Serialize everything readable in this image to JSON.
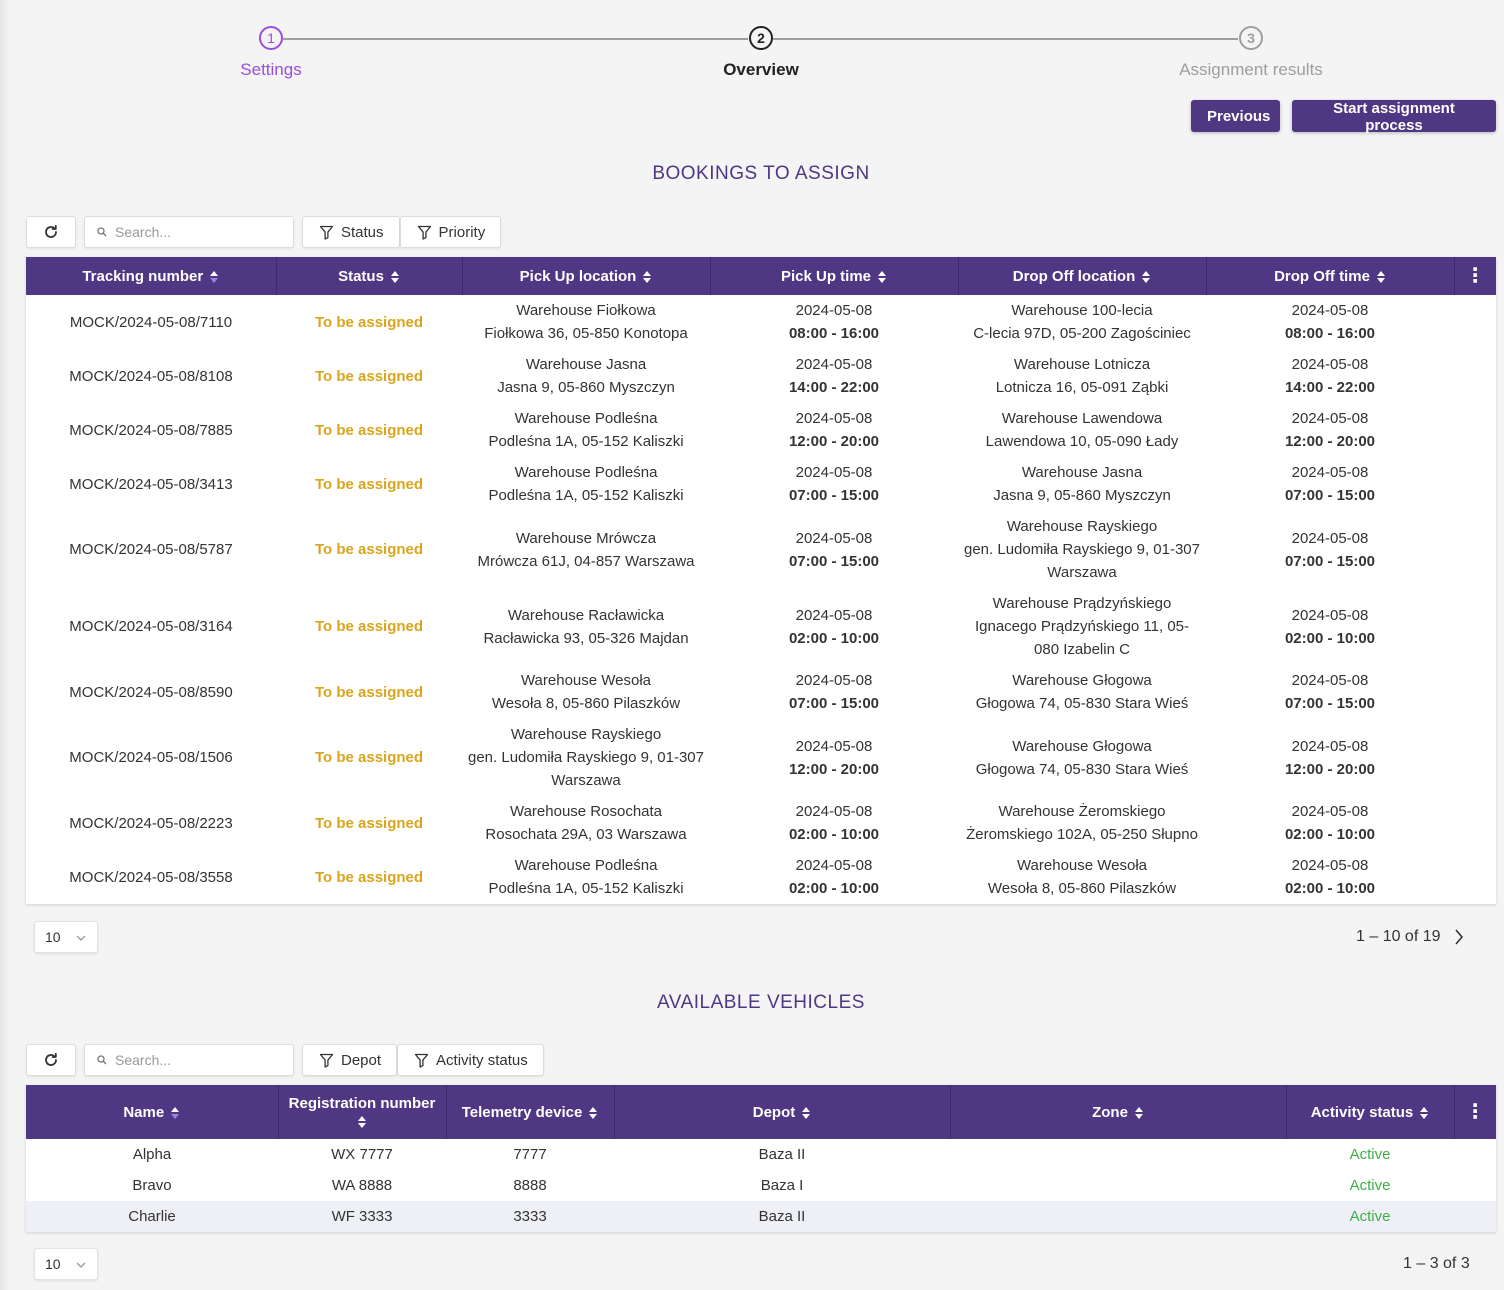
{
  "stepper": {
    "steps": [
      {
        "number": "1",
        "label": "Settings",
        "state": "done"
      },
      {
        "number": "2",
        "label": "Overview",
        "state": "active"
      },
      {
        "number": "3",
        "label": "Assignment results",
        "state": "pending"
      }
    ]
  },
  "actions": {
    "previous_label": "Previous",
    "start_label": "Start assignment process"
  },
  "bookings": {
    "title": "BOOKINGS TO ASSIGN",
    "search_placeholder": "Search...",
    "filters": [
      "Status",
      "Priority"
    ],
    "columns": [
      "Tracking number",
      "Status",
      "Pick Up location",
      "Pick Up time",
      "Drop Off location",
      "Drop Off time"
    ],
    "rows": [
      {
        "tracking": "MOCK/2024-05-08/7110",
        "status": "To be assigned",
        "pickup_name": "Warehouse Fiołkowa",
        "pickup_addr": "Fiołkowa 36, 05-850 Konotopa",
        "pickup_date": "2024-05-08",
        "pickup_time": "08:00 - 16:00",
        "drop_name": "Warehouse 100-lecia",
        "drop_addr": "C-lecia 97D, 05-200 Zagościniec",
        "drop_date": "2024-05-08",
        "drop_time": "08:00 - 16:00"
      },
      {
        "tracking": "MOCK/2024-05-08/8108",
        "status": "To be assigned",
        "pickup_name": "Warehouse Jasna",
        "pickup_addr": "Jasna 9, 05-860 Myszczyn",
        "pickup_date": "2024-05-08",
        "pickup_time": "14:00 - 22:00",
        "drop_name": "Warehouse Lotnicza",
        "drop_addr": "Lotnicza 16, 05-091 Ząbki",
        "drop_date": "2024-05-08",
        "drop_time": "14:00 - 22:00"
      },
      {
        "tracking": "MOCK/2024-05-08/7885",
        "status": "To be assigned",
        "pickup_name": "Warehouse Podleśna",
        "pickup_addr": "Podleśna 1A, 05-152 Kaliszki",
        "pickup_date": "2024-05-08",
        "pickup_time": "12:00 - 20:00",
        "drop_name": "Warehouse Lawendowa",
        "drop_addr": "Lawendowa 10, 05-090 Łady",
        "drop_date": "2024-05-08",
        "drop_time": "12:00 - 20:00"
      },
      {
        "tracking": "MOCK/2024-05-08/3413",
        "status": "To be assigned",
        "pickup_name": "Warehouse Podleśna",
        "pickup_addr": "Podleśna 1A, 05-152 Kaliszki",
        "pickup_date": "2024-05-08",
        "pickup_time": "07:00 - 15:00",
        "drop_name": "Warehouse Jasna",
        "drop_addr": "Jasna 9, 05-860 Myszczyn",
        "drop_date": "2024-05-08",
        "drop_time": "07:00 - 15:00"
      },
      {
        "tracking": "MOCK/2024-05-08/5787",
        "status": "To be assigned",
        "pickup_name": "Warehouse Mrówcza",
        "pickup_addr": "Mrówcza 61J, 04-857 Warszawa",
        "pickup_date": "2024-05-08",
        "pickup_time": "07:00 - 15:00",
        "drop_name": "Warehouse Rayskiego",
        "drop_addr": "gen. Ludomiła Rayskiego 9, 01-307 Warszawa",
        "drop_date": "2024-05-08",
        "drop_time": "07:00 - 15:00"
      },
      {
        "tracking": "MOCK/2024-05-08/3164",
        "status": "To be assigned",
        "pickup_name": "Warehouse Racławicka",
        "pickup_addr": "Racławicka 93, 05-326 Majdan",
        "pickup_date": "2024-05-08",
        "pickup_time": "02:00 - 10:00",
        "drop_name": "Warehouse Prądzyńskiego",
        "drop_addr": "Ignacego Prądzyńskiego 11, 05-080 Izabelin C",
        "drop_date": "2024-05-08",
        "drop_time": "02:00 - 10:00"
      },
      {
        "tracking": "MOCK/2024-05-08/8590",
        "status": "To be assigned",
        "pickup_name": "Warehouse Wesoła",
        "pickup_addr": "Wesoła 8, 05-860 Pilaszków",
        "pickup_date": "2024-05-08",
        "pickup_time": "07:00 - 15:00",
        "drop_name": "Warehouse Głogowa",
        "drop_addr": "Głogowa 74, 05-830 Stara Wieś",
        "drop_date": "2024-05-08",
        "drop_time": "07:00 - 15:00"
      },
      {
        "tracking": "MOCK/2024-05-08/1506",
        "status": "To be assigned",
        "pickup_name": "Warehouse Rayskiego",
        "pickup_addr": "gen. Ludomiła Rayskiego 9, 01-307 Warszawa",
        "pickup_date": "2024-05-08",
        "pickup_time": "12:00 - 20:00",
        "drop_name": "Warehouse Głogowa",
        "drop_addr": "Głogowa 74, 05-830 Stara Wieś",
        "drop_date": "2024-05-08",
        "drop_time": "12:00 - 20:00"
      },
      {
        "tracking": "MOCK/2024-05-08/2223",
        "status": "To be assigned",
        "pickup_name": "Warehouse Rosochata",
        "pickup_addr": "Rosochata 29A, 03 Warszawa",
        "pickup_date": "2024-05-08",
        "pickup_time": "02:00 - 10:00",
        "drop_name": "Warehouse Żeromskiego",
        "drop_addr": "Żeromskiego 102A, 05-250 Słupno",
        "drop_date": "2024-05-08",
        "drop_time": "02:00 - 10:00"
      },
      {
        "tracking": "MOCK/2024-05-08/3558",
        "status": "To be assigned",
        "pickup_name": "Warehouse Podleśna",
        "pickup_addr": "Podleśna 1A, 05-152 Kaliszki",
        "pickup_date": "2024-05-08",
        "pickup_time": "02:00 - 10:00",
        "drop_name": "Warehouse Wesoła",
        "drop_addr": "Wesoła 8, 05-860 Pilaszków",
        "drop_date": "2024-05-08",
        "drop_time": "02:00 - 10:00"
      }
    ],
    "page_size": "10",
    "page_info": "1 – 10 of 19"
  },
  "vehicles": {
    "title": "AVAILABLE VEHICLES",
    "search_placeholder": "Search...",
    "filters": [
      "Depot",
      "Activity status"
    ],
    "columns": [
      "Name",
      "Registration number",
      "Telemetry device",
      "Depot",
      "Zone",
      "Activity status"
    ],
    "rows": [
      {
        "name": "Alpha",
        "registration": "WX 7777",
        "telemetry": "7777",
        "depot": "Baza II",
        "zone": "",
        "activity": "Active"
      },
      {
        "name": "Bravo",
        "registration": "WA 8888",
        "telemetry": "8888",
        "depot": "Baza I",
        "zone": "",
        "activity": "Active"
      },
      {
        "name": "Charlie",
        "registration": "WF 3333",
        "telemetry": "3333",
        "depot": "Baza II",
        "zone": "",
        "activity": "Active"
      }
    ],
    "page_size": "10",
    "page_info": "1 – 3 of 3"
  },
  "colors": {
    "brand": "#4f3783",
    "step_done": "#9c4ddc",
    "status_to_be_assigned": "#d9a51e",
    "status_active": "#3fae49"
  }
}
